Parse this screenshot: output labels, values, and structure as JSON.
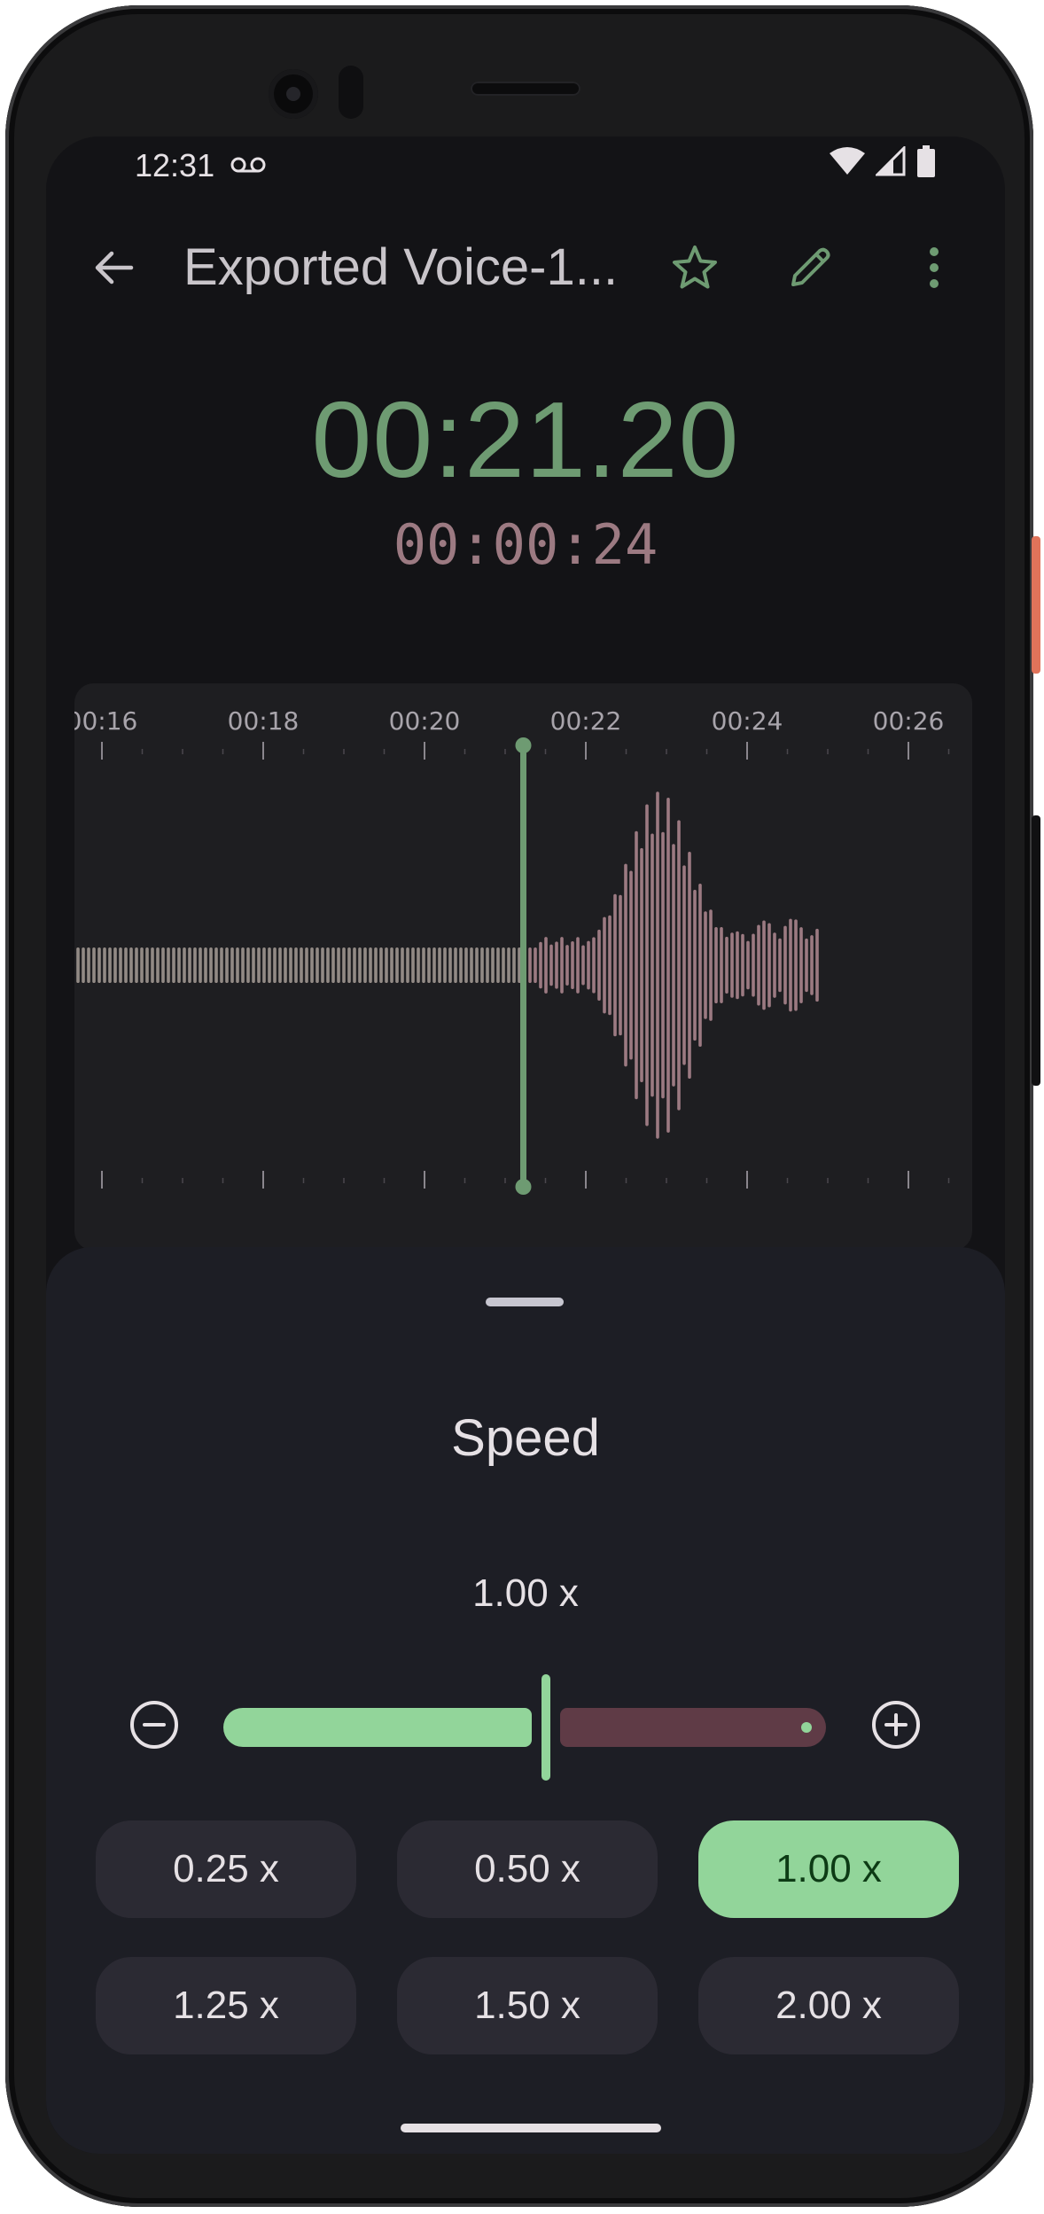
{
  "status_bar": {
    "time": "12:31"
  },
  "app_bar": {
    "title": "Exported Voice-1..."
  },
  "player": {
    "elapsed": "00:21.20",
    "frame_time": "00:00:24"
  },
  "waveform": {
    "tick_labels": [
      "00:16",
      "00:18",
      "00:20",
      "00:22",
      "00:24",
      "00:26"
    ],
    "playhead_position": 0.5,
    "colors": {
      "playhead": "#6e9b72",
      "played": "#9e9690",
      "unplayed": "#9c7a82"
    }
  },
  "speed_sheet": {
    "title": "Speed",
    "current_value": "1.00 x",
    "slider_fraction": 0.4,
    "presets": [
      {
        "label": "0.25 x",
        "selected": false
      },
      {
        "label": "0.50 x",
        "selected": false
      },
      {
        "label": "1.00 x",
        "selected": true
      },
      {
        "label": "1.25 x",
        "selected": false
      },
      {
        "label": "1.50 x",
        "selected": false
      },
      {
        "label": "2.00 x",
        "selected": false
      }
    ]
  },
  "colors": {
    "accent": "#92d59a",
    "accent_dim": "#6e9b72",
    "secondary": "#9c7a82",
    "surface": "#1d1e25"
  },
  "icons": [
    "arrow-back-icon",
    "star-outline-icon",
    "pencil-icon",
    "more-vert-icon",
    "voicemail-icon",
    "wifi-icon",
    "signal-icon",
    "battery-icon",
    "minus-circle-icon",
    "plus-circle-icon"
  ]
}
